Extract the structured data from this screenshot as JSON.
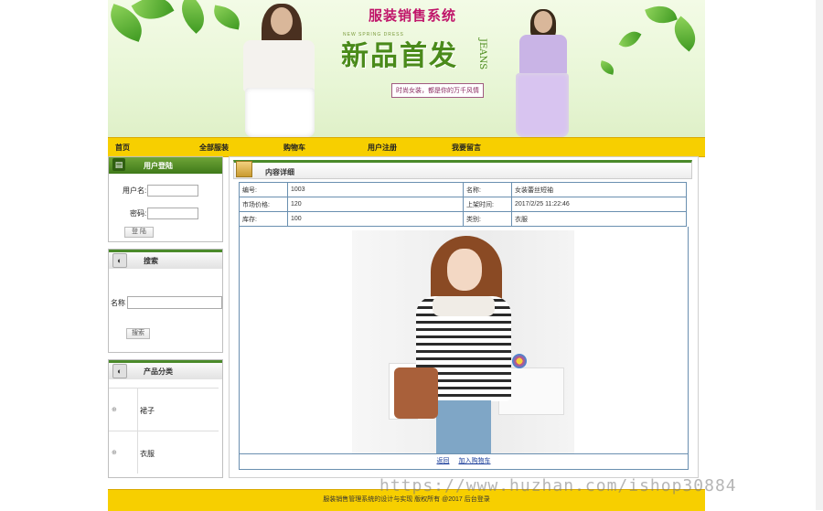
{
  "banner": {
    "system_title": "服装销售系统",
    "spring_tag": "NEW SPRING DRESS",
    "new_arrival": "新品首发",
    "jeans": "JEANS",
    "slogan": "时尚女装，都是你的万千风情"
  },
  "nav": {
    "items": [
      {
        "label": "首页"
      },
      {
        "label": "全部服装"
      },
      {
        "label": "购物车"
      },
      {
        "label": "用户注册"
      },
      {
        "label": "我要留言"
      }
    ]
  },
  "login": {
    "title": "用户登陆",
    "username_label": "用户名:",
    "password_label": "密码:",
    "submit_label": "登 陆"
  },
  "search": {
    "title": "搜索",
    "name_label": "名称",
    "submit_label": "搜索"
  },
  "category": {
    "title": "产品分类",
    "items": [
      {
        "label": "裙子"
      },
      {
        "label": "衣服"
      }
    ]
  },
  "detail": {
    "title": "内容详细",
    "rows": [
      [
        "编号:",
        "1003",
        "名称:",
        "女装蕾丝短袖"
      ],
      [
        "市场价格:",
        "120",
        "上架时间:",
        "2017/2/25 11:22:46"
      ],
      [
        "库存:",
        "100",
        "类别:",
        "衣服"
      ]
    ],
    "back_link": "返回",
    "add_cart_link": "加入购物车"
  },
  "footer": {
    "text": "服装销售管理系统的设计与实现    版权所有 @2017   后台登录"
  },
  "watermark": "https://www.huzhan.com/ishop30884",
  "colors": {
    "nav_yellow": "#f7cf00",
    "header_green": "#4a8a2a",
    "title_pink": "#c0156a",
    "table_border": "#6a8fb0"
  }
}
